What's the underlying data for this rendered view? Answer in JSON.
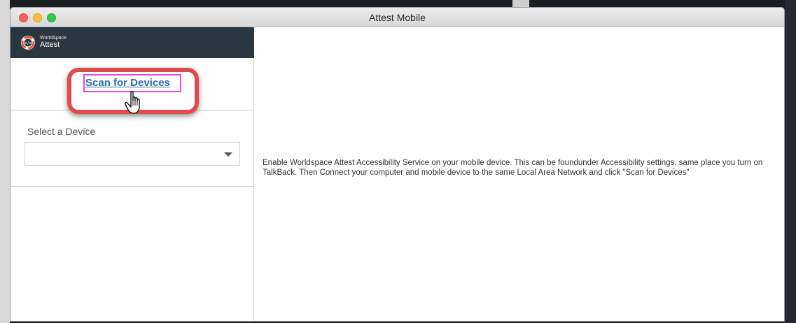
{
  "window": {
    "title": "Attest Mobile"
  },
  "brand": {
    "line1": "WorldSpace",
    "line2": "Attest",
    "logo_icon": "attest-logo-icon"
  },
  "scan": {
    "label": "Scan for Devices",
    "cursor_icon": "hand-pointer-icon",
    "highlight_color": "#e04a4a"
  },
  "device": {
    "label": "Select a Device",
    "selected_value": "",
    "caret_icon": "caret-down-icon"
  },
  "main": {
    "instructions": "Enable Worldspace Attest Accessibility Service on your mobile device. This can be foundunder Accessibility settings, same place you turn on TalkBack. Then Connect your computer and mobile device to the same Local Area Network and click \"Scan for Devices\""
  },
  "colors": {
    "brand_bar": "#2a3640",
    "link": "#2b6ea8"
  }
}
